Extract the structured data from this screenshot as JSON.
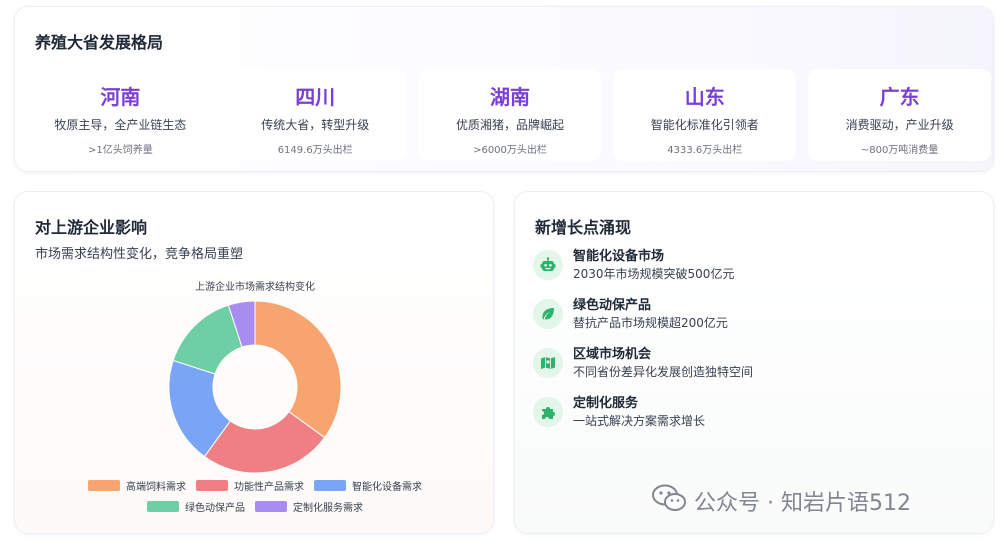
{
  "provinces_section": {
    "title": "养殖大省发展格局",
    "provinces": [
      {
        "name": "河南",
        "desc": "牧原主导，全产业链生态",
        "stat": ">1亿头饲养量"
      },
      {
        "name": "四川",
        "desc": "传统大省，转型升级",
        "stat": "6149.6万头出栏"
      },
      {
        "name": "湖南",
        "desc": "优质湘猪，品牌崛起",
        "stat": ">6000万头出栏"
      },
      {
        "name": "山东",
        "desc": "智能化标准化引领者",
        "stat": "4333.6万头出栏"
      },
      {
        "name": "广东",
        "desc": "消费驱动，产业升级",
        "stat": "~800万吨消费量"
      }
    ]
  },
  "upstream_section": {
    "title": "对上游企业影响",
    "subtitle": "市场需求结构性变化，竞争格局重塑"
  },
  "chart_data": {
    "type": "pie",
    "title": "上游企业市场需求结构变化",
    "categories": [
      "高端饲料需求",
      "功能性产品需求",
      "智能化设备需求",
      "绿色动保产品",
      "定制化服务需求"
    ],
    "values": [
      35,
      25,
      20,
      15,
      5
    ],
    "colors": [
      "#f8a46e",
      "#f07f83",
      "#7aa4f5",
      "#6dcfa3",
      "#a98cf0"
    ],
    "donut": true,
    "legend": "bottom"
  },
  "growth_section": {
    "title": "新增长点涌现",
    "items": [
      {
        "icon": "robot-icon",
        "title": "智能化设备市场",
        "desc": "2030年市场规模突破500亿元"
      },
      {
        "icon": "leaf-icon",
        "title": "绿色动保产品",
        "desc": "替抗产品市场规模超200亿元"
      },
      {
        "icon": "map-icon",
        "title": "区域市场机会",
        "desc": "不同省份差异化发展创造独特空间"
      },
      {
        "icon": "puzzle-icon",
        "title": "定制化服务",
        "desc": "一站式解决方案需求增长"
      }
    ],
    "icon_color": "#2fb36a"
  },
  "watermark": {
    "text": "公众号 · 知岩片语512",
    "icon": "wechat-icon"
  }
}
